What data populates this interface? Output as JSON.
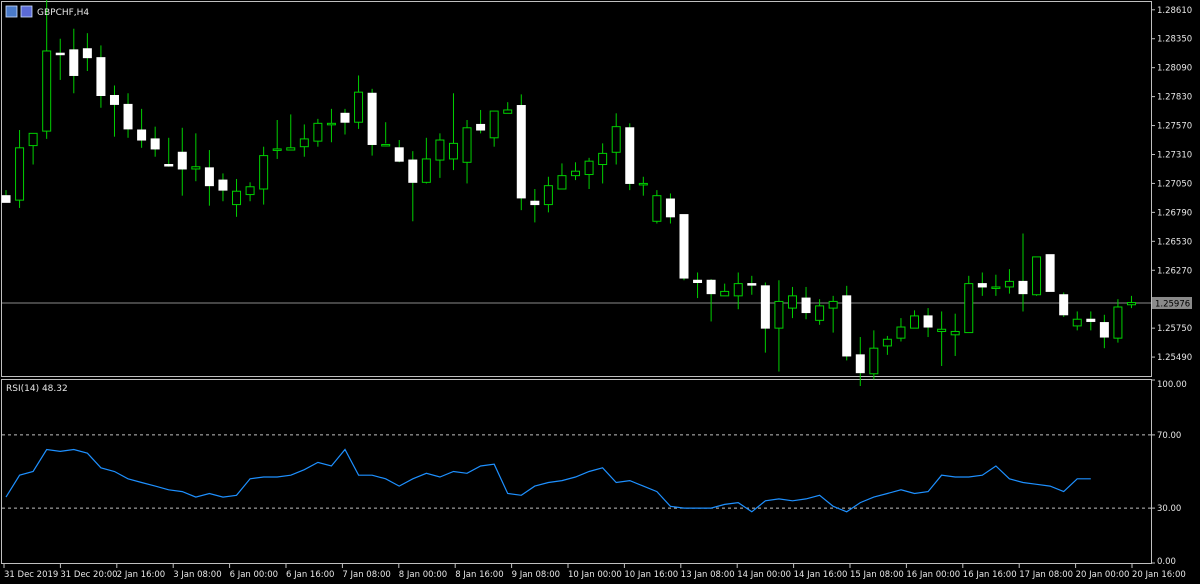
{
  "window": {
    "symbol_title": "GBPCHF,H4",
    "indicator_title": "RSI(14) 48.32"
  },
  "colors": {
    "background": "#000000",
    "bull_body": "#000000",
    "bear_body": "#ffffff",
    "wick": "#00d000",
    "rsi_line": "#1e90ff",
    "grid_frame": "#bfbfbf",
    "current_price_line": "#8a8a8a",
    "price_tag": "#8a8a8a"
  },
  "price_axis": {
    "labels": [
      "1.28610",
      "1.28350",
      "1.28090",
      "1.27830",
      "1.27570",
      "1.27310",
      "1.27050",
      "1.26790",
      "1.26530",
      "1.26270",
      "1.25750",
      "1.25490"
    ],
    "current_price": "1.25976"
  },
  "rsi_axis": {
    "labels": [
      "100.00",
      "70.00",
      "30.00",
      "0.00"
    ],
    "levels": [
      70,
      30
    ]
  },
  "time_axis": {
    "labels": [
      "31 Dec 2019",
      "31 Dec 20:00",
      "2 Jan 16:00",
      "3 Jan 08:00",
      "6 Jan 00:00",
      "6 Jan 16:00",
      "7 Jan 08:00",
      "8 Jan 00:00",
      "8 Jan 16:00",
      "9 Jan 08:00",
      "10 Jan 00:00",
      "10 Jan 16:00",
      "13 Jan 08:00",
      "14 Jan 00:00",
      "14 Jan 16:00",
      "15 Jan 08:00",
      "16 Jan 00:00",
      "16 Jan 16:00",
      "17 Jan 08:00",
      "20 Jan 00:00",
      "20 Jan 16:00"
    ]
  },
  "chart_data": [
    {
      "type": "candlestick",
      "title": "GBPCHF,H4",
      "ylim": [
        1.2532,
        1.2868
      ],
      "candles": [
        {
          "o": 1.2694,
          "h": 1.2699,
          "l": 1.2689,
          "c": 1.2688
        },
        {
          "o": 1.269,
          "h": 1.2753,
          "l": 1.2683,
          "c": 1.2737
        },
        {
          "o": 1.2739,
          "h": 1.2749,
          "l": 1.2722,
          "c": 1.275
        },
        {
          "o": 1.2752,
          "h": 1.2871,
          "l": 1.2745,
          "c": 1.2824
        },
        {
          "o": 1.2822,
          "h": 1.2835,
          "l": 1.2798,
          "c": 1.2821
        },
        {
          "o": 1.2825,
          "h": 1.2844,
          "l": 1.2786,
          "c": 1.2802
        },
        {
          "o": 1.2826,
          "h": 1.284,
          "l": 1.2806,
          "c": 1.2818
        },
        {
          "o": 1.2818,
          "h": 1.2829,
          "l": 1.2773,
          "c": 1.2784
        },
        {
          "o": 1.2784,
          "h": 1.2793,
          "l": 1.2747,
          "c": 1.2776
        },
        {
          "o": 1.2776,
          "h": 1.2786,
          "l": 1.2746,
          "c": 1.2754
        },
        {
          "o": 1.2753,
          "h": 1.2772,
          "l": 1.2737,
          "c": 1.2744
        },
        {
          "o": 1.2745,
          "h": 1.2756,
          "l": 1.2729,
          "c": 1.2736
        },
        {
          "o": 1.2722,
          "h": 1.2746,
          "l": 1.272,
          "c": 1.2721
        },
        {
          "o": 1.2733,
          "h": 1.2755,
          "l": 1.2694,
          "c": 1.2718
        },
        {
          "o": 1.2718,
          "h": 1.275,
          "l": 1.2707,
          "c": 1.272
        },
        {
          "o": 1.2719,
          "h": 1.2735,
          "l": 1.2685,
          "c": 1.2703
        },
        {
          "o": 1.2708,
          "h": 1.2714,
          "l": 1.2689,
          "c": 1.2699
        },
        {
          "o": 1.2686,
          "h": 1.2709,
          "l": 1.2675,
          "c": 1.2698
        },
        {
          "o": 1.2695,
          "h": 1.2706,
          "l": 1.2689,
          "c": 1.2702
        },
        {
          "o": 1.27,
          "h": 1.2738,
          "l": 1.2686,
          "c": 1.273
        },
        {
          "o": 1.2735,
          "h": 1.2762,
          "l": 1.2727,
          "c": 1.2736
        },
        {
          "o": 1.2735,
          "h": 1.2767,
          "l": 1.2735,
          "c": 1.2737
        },
        {
          "o": 1.2738,
          "h": 1.2758,
          "l": 1.2729,
          "c": 1.2745
        },
        {
          "o": 1.2743,
          "h": 1.2763,
          "l": 1.2738,
          "c": 1.2759
        },
        {
          "o": 1.2759,
          "h": 1.2772,
          "l": 1.2742,
          "c": 1.2759
        },
        {
          "o": 1.2768,
          "h": 1.2772,
          "l": 1.2749,
          "c": 1.276
        },
        {
          "o": 1.276,
          "h": 1.2802,
          "l": 1.2754,
          "c": 1.2787
        },
        {
          "o": 1.2786,
          "h": 1.279,
          "l": 1.273,
          "c": 1.274
        },
        {
          "o": 1.274,
          "h": 1.276,
          "l": 1.2741,
          "c": 1.274
        },
        {
          "o": 1.2737,
          "h": 1.2744,
          "l": 1.2724,
          "c": 1.2725
        },
        {
          "o": 1.2726,
          "h": 1.2734,
          "l": 1.2671,
          "c": 1.2706
        },
        {
          "o": 1.2706,
          "h": 1.2746,
          "l": 1.2705,
          "c": 1.2727
        },
        {
          "o": 1.2726,
          "h": 1.275,
          "l": 1.271,
          "c": 1.2744
        },
        {
          "o": 1.2727,
          "h": 1.2786,
          "l": 1.2717,
          "c": 1.2741
        },
        {
          "o": 1.2724,
          "h": 1.2762,
          "l": 1.2705,
          "c": 1.2755
        },
        {
          "o": 1.2758,
          "h": 1.2771,
          "l": 1.275,
          "c": 1.2753
        },
        {
          "o": 1.2746,
          "h": 1.2768,
          "l": 1.2738,
          "c": 1.277
        },
        {
          "o": 1.2768,
          "h": 1.2778,
          "l": 1.2768,
          "c": 1.2771
        },
        {
          "o": 1.2775,
          "h": 1.2785,
          "l": 1.2681,
          "c": 1.2692
        },
        {
          "o": 1.2689,
          "h": 1.27,
          "l": 1.267,
          "c": 1.2686
        },
        {
          "o": 1.2686,
          "h": 1.2711,
          "l": 1.2679,
          "c": 1.2703
        },
        {
          "o": 1.27,
          "h": 1.2723,
          "l": 1.27,
          "c": 1.2712
        },
        {
          "o": 1.2712,
          "h": 1.2724,
          "l": 1.2708,
          "c": 1.2716
        },
        {
          "o": 1.2713,
          "h": 1.2728,
          "l": 1.27,
          "c": 1.2725
        },
        {
          "o": 1.2722,
          "h": 1.2741,
          "l": 1.2705,
          "c": 1.2732
        },
        {
          "o": 1.2733,
          "h": 1.2768,
          "l": 1.2722,
          "c": 1.2756
        },
        {
          "o": 1.2755,
          "h": 1.2759,
          "l": 1.2699,
          "c": 1.2705
        },
        {
          "o": 1.2705,
          "h": 1.2711,
          "l": 1.2694,
          "c": 1.2705
        },
        {
          "o": 1.2671,
          "h": 1.2699,
          "l": 1.2669,
          "c": 1.2694
        },
        {
          "o": 1.2691,
          "h": 1.2696,
          "l": 1.2669,
          "c": 1.2675
        },
        {
          "o": 1.2677,
          "h": 1.2677,
          "l": 1.2618,
          "c": 1.262
        },
        {
          "o": 1.2618,
          "h": 1.2625,
          "l": 1.2602,
          "c": 1.2616
        },
        {
          "o": 1.2618,
          "h": 1.2619,
          "l": 1.2581,
          "c": 1.2606
        },
        {
          "o": 1.2604,
          "h": 1.2615,
          "l": 1.2605,
          "c": 1.2608
        },
        {
          "o": 1.2604,
          "h": 1.2625,
          "l": 1.2592,
          "c": 1.2615
        },
        {
          "o": 1.2615,
          "h": 1.2622,
          "l": 1.2605,
          "c": 1.2614
        },
        {
          "o": 1.2613,
          "h": 1.2616,
          "l": 1.2553,
          "c": 1.2575
        },
        {
          "o": 1.2575,
          "h": 1.2618,
          "l": 1.2536,
          "c": 1.2599
        },
        {
          "o": 1.2593,
          "h": 1.2612,
          "l": 1.2584,
          "c": 1.2604
        },
        {
          "o": 1.2602,
          "h": 1.2612,
          "l": 1.2583,
          "c": 1.2589
        },
        {
          "o": 1.2582,
          "h": 1.2601,
          "l": 1.2578,
          "c": 1.2595
        },
        {
          "o": 1.2593,
          "h": 1.2604,
          "l": 1.2571,
          "c": 1.2599
        },
        {
          "o": 1.2604,
          "h": 1.2613,
          "l": 1.2546,
          "c": 1.255
        },
        {
          "o": 1.2551,
          "h": 1.2567,
          "l": 1.2523,
          "c": 1.2535
        },
        {
          "o": 1.2534,
          "h": 1.2573,
          "l": 1.2529,
          "c": 1.2557
        },
        {
          "o": 1.2559,
          "h": 1.2568,
          "l": 1.2551,
          "c": 1.2565
        },
        {
          "o": 1.2566,
          "h": 1.2584,
          "l": 1.2563,
          "c": 1.2576
        },
        {
          "o": 1.2575,
          "h": 1.2591,
          "l": 1.2576,
          "c": 1.2586
        },
        {
          "o": 1.2586,
          "h": 1.2593,
          "l": 1.2567,
          "c": 1.2576
        },
        {
          "o": 1.2572,
          "h": 1.259,
          "l": 1.2541,
          "c": 1.2574
        },
        {
          "o": 1.2569,
          "h": 1.2588,
          "l": 1.255,
          "c": 1.2572
        },
        {
          "o": 1.2571,
          "h": 1.2622,
          "l": 1.2579,
          "c": 1.2615
        },
        {
          "o": 1.2615,
          "h": 1.2625,
          "l": 1.2604,
          "c": 1.2612
        },
        {
          "o": 1.2611,
          "h": 1.2623,
          "l": 1.2604,
          "c": 1.2612
        },
        {
          "o": 1.2612,
          "h": 1.2628,
          "l": 1.2606,
          "c": 1.2617
        },
        {
          "o": 1.2617,
          "h": 1.266,
          "l": 1.259,
          "c": 1.2606
        },
        {
          "o": 1.2605,
          "h": 1.2639,
          "l": 1.2604,
          "c": 1.2639
        },
        {
          "o": 1.2641,
          "h": 1.264,
          "l": 1.2613,
          "c": 1.2608
        },
        {
          "o": 1.2605,
          "h": 1.2607,
          "l": 1.2585,
          "c": 1.2587
        },
        {
          "o": 1.2577,
          "h": 1.259,
          "l": 1.2573,
          "c": 1.2583
        },
        {
          "o": 1.2583,
          "h": 1.259,
          "l": 1.2573,
          "c": 1.2581
        },
        {
          "o": 1.258,
          "h": 1.2587,
          "l": 1.2557,
          "c": 1.2567
        },
        {
          "o": 1.2566,
          "h": 1.2601,
          "l": 1.2562,
          "c": 1.2594
        },
        {
          "o": 1.2596,
          "h": 1.2604,
          "l": 1.2593,
          "c": 1.2598
        }
      ]
    },
    {
      "type": "line",
      "title": "RSI(14) 48.32",
      "ylim": [
        0,
        100
      ],
      "levels": [
        70,
        30
      ],
      "series": [
        {
          "values": [
            36,
            48,
            50,
            62,
            61,
            62,
            60,
            52,
            50,
            46,
            44,
            42,
            40,
            39,
            36,
            38,
            36,
            37,
            46,
            47,
            47,
            48,
            51,
            55,
            53,
            62,
            48,
            48,
            46,
            42,
            46,
            49,
            47,
            50,
            49,
            53,
            54,
            38,
            37,
            42,
            44,
            45,
            47,
            50,
            52,
            44,
            45,
            42,
            39,
            31,
            30,
            30,
            30,
            32,
            33,
            28,
            34,
            35,
            34,
            35,
            37,
            31,
            28,
            33,
            36,
            38,
            40,
            38,
            39,
            48,
            47,
            47,
            48,
            53,
            46,
            44,
            43,
            42,
            39,
            46,
            46
          ]
        }
      ]
    }
  ]
}
